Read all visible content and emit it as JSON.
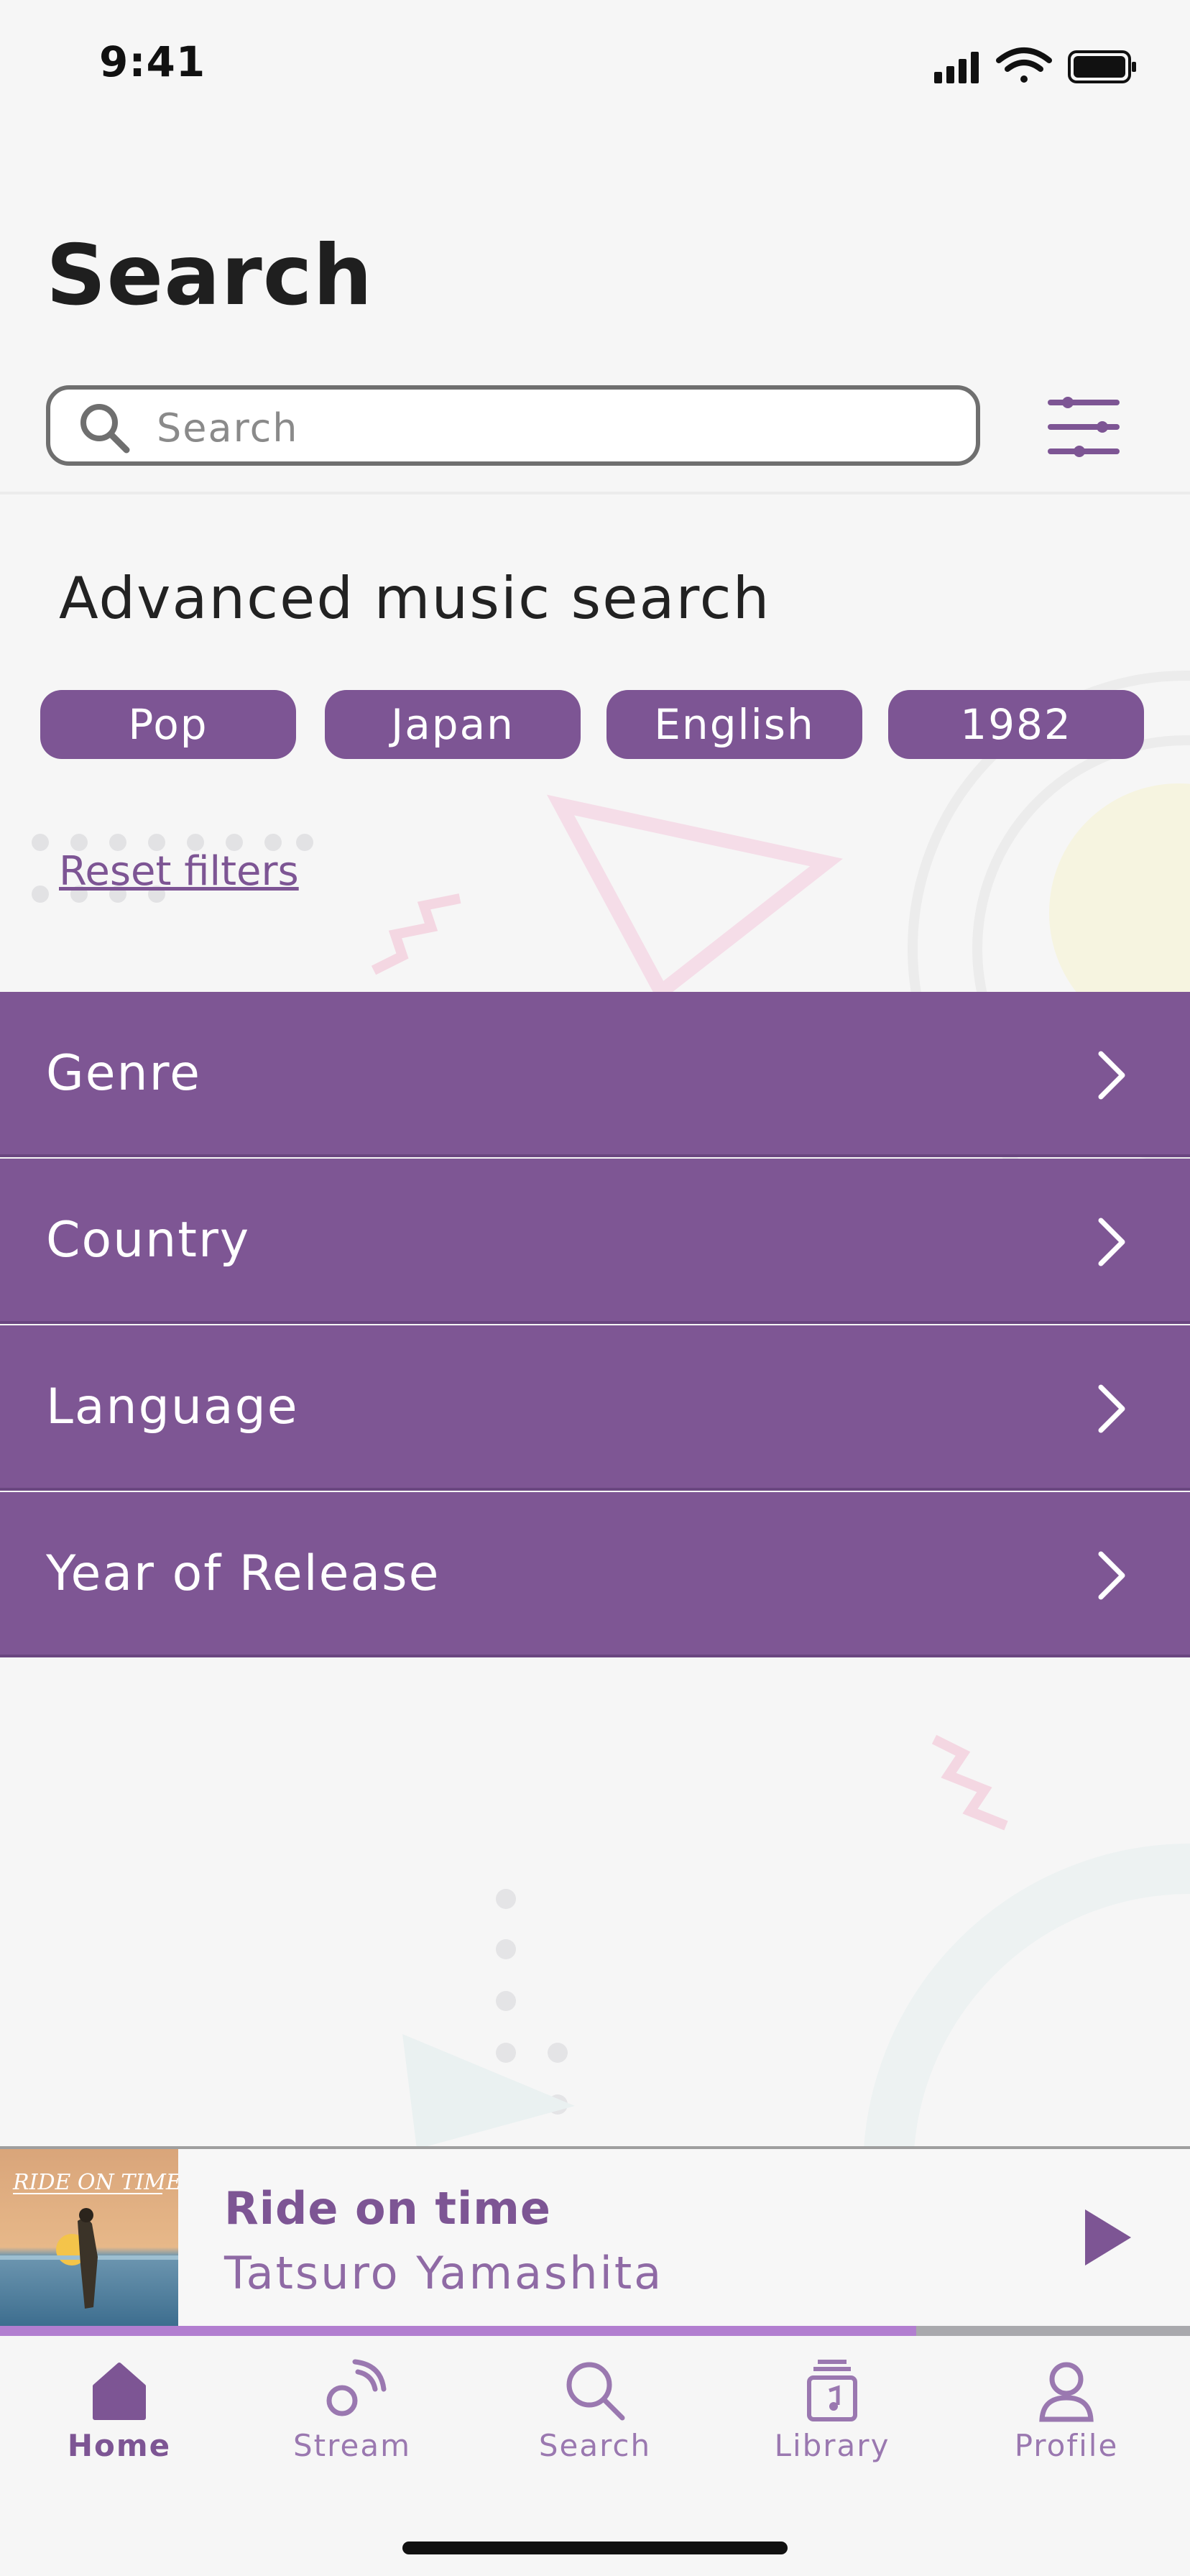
{
  "status_bar": {
    "time": "9:41",
    "icons": [
      "signal-icon",
      "wifi-icon",
      "battery-icon"
    ]
  },
  "header": {
    "title": "Search",
    "search": {
      "placeholder": "Search",
      "value": ""
    },
    "filter_icon": "filter-sliders-icon"
  },
  "advanced": {
    "title": "Advanced music search",
    "chips": [
      "Pop",
      "Japan",
      "English",
      "1982"
    ],
    "reset_label": "Reset filters"
  },
  "categories": [
    {
      "label": "Genre"
    },
    {
      "label": "Country"
    },
    {
      "label": "Language"
    },
    {
      "label": "Year of Release"
    }
  ],
  "now_playing": {
    "album_art_text": "RIDE ON TIME",
    "title": "Ride on time",
    "artist": "Tatsuro Yamashita",
    "progress": 0.77
  },
  "tabs": [
    {
      "label": "Home",
      "icon": "home-icon",
      "active": true
    },
    {
      "label": "Stream",
      "icon": "stream-icon",
      "active": false
    },
    {
      "label": "Search",
      "icon": "search-icon",
      "active": false
    },
    {
      "label": "Library",
      "icon": "library-icon",
      "active": false
    },
    {
      "label": "Profile",
      "icon": "profile-icon",
      "active": false
    }
  ],
  "colors": {
    "accent": "#7d5594",
    "row_background": "#7e5694",
    "progress": "#b27ed0",
    "background": "#f6f6f6"
  }
}
